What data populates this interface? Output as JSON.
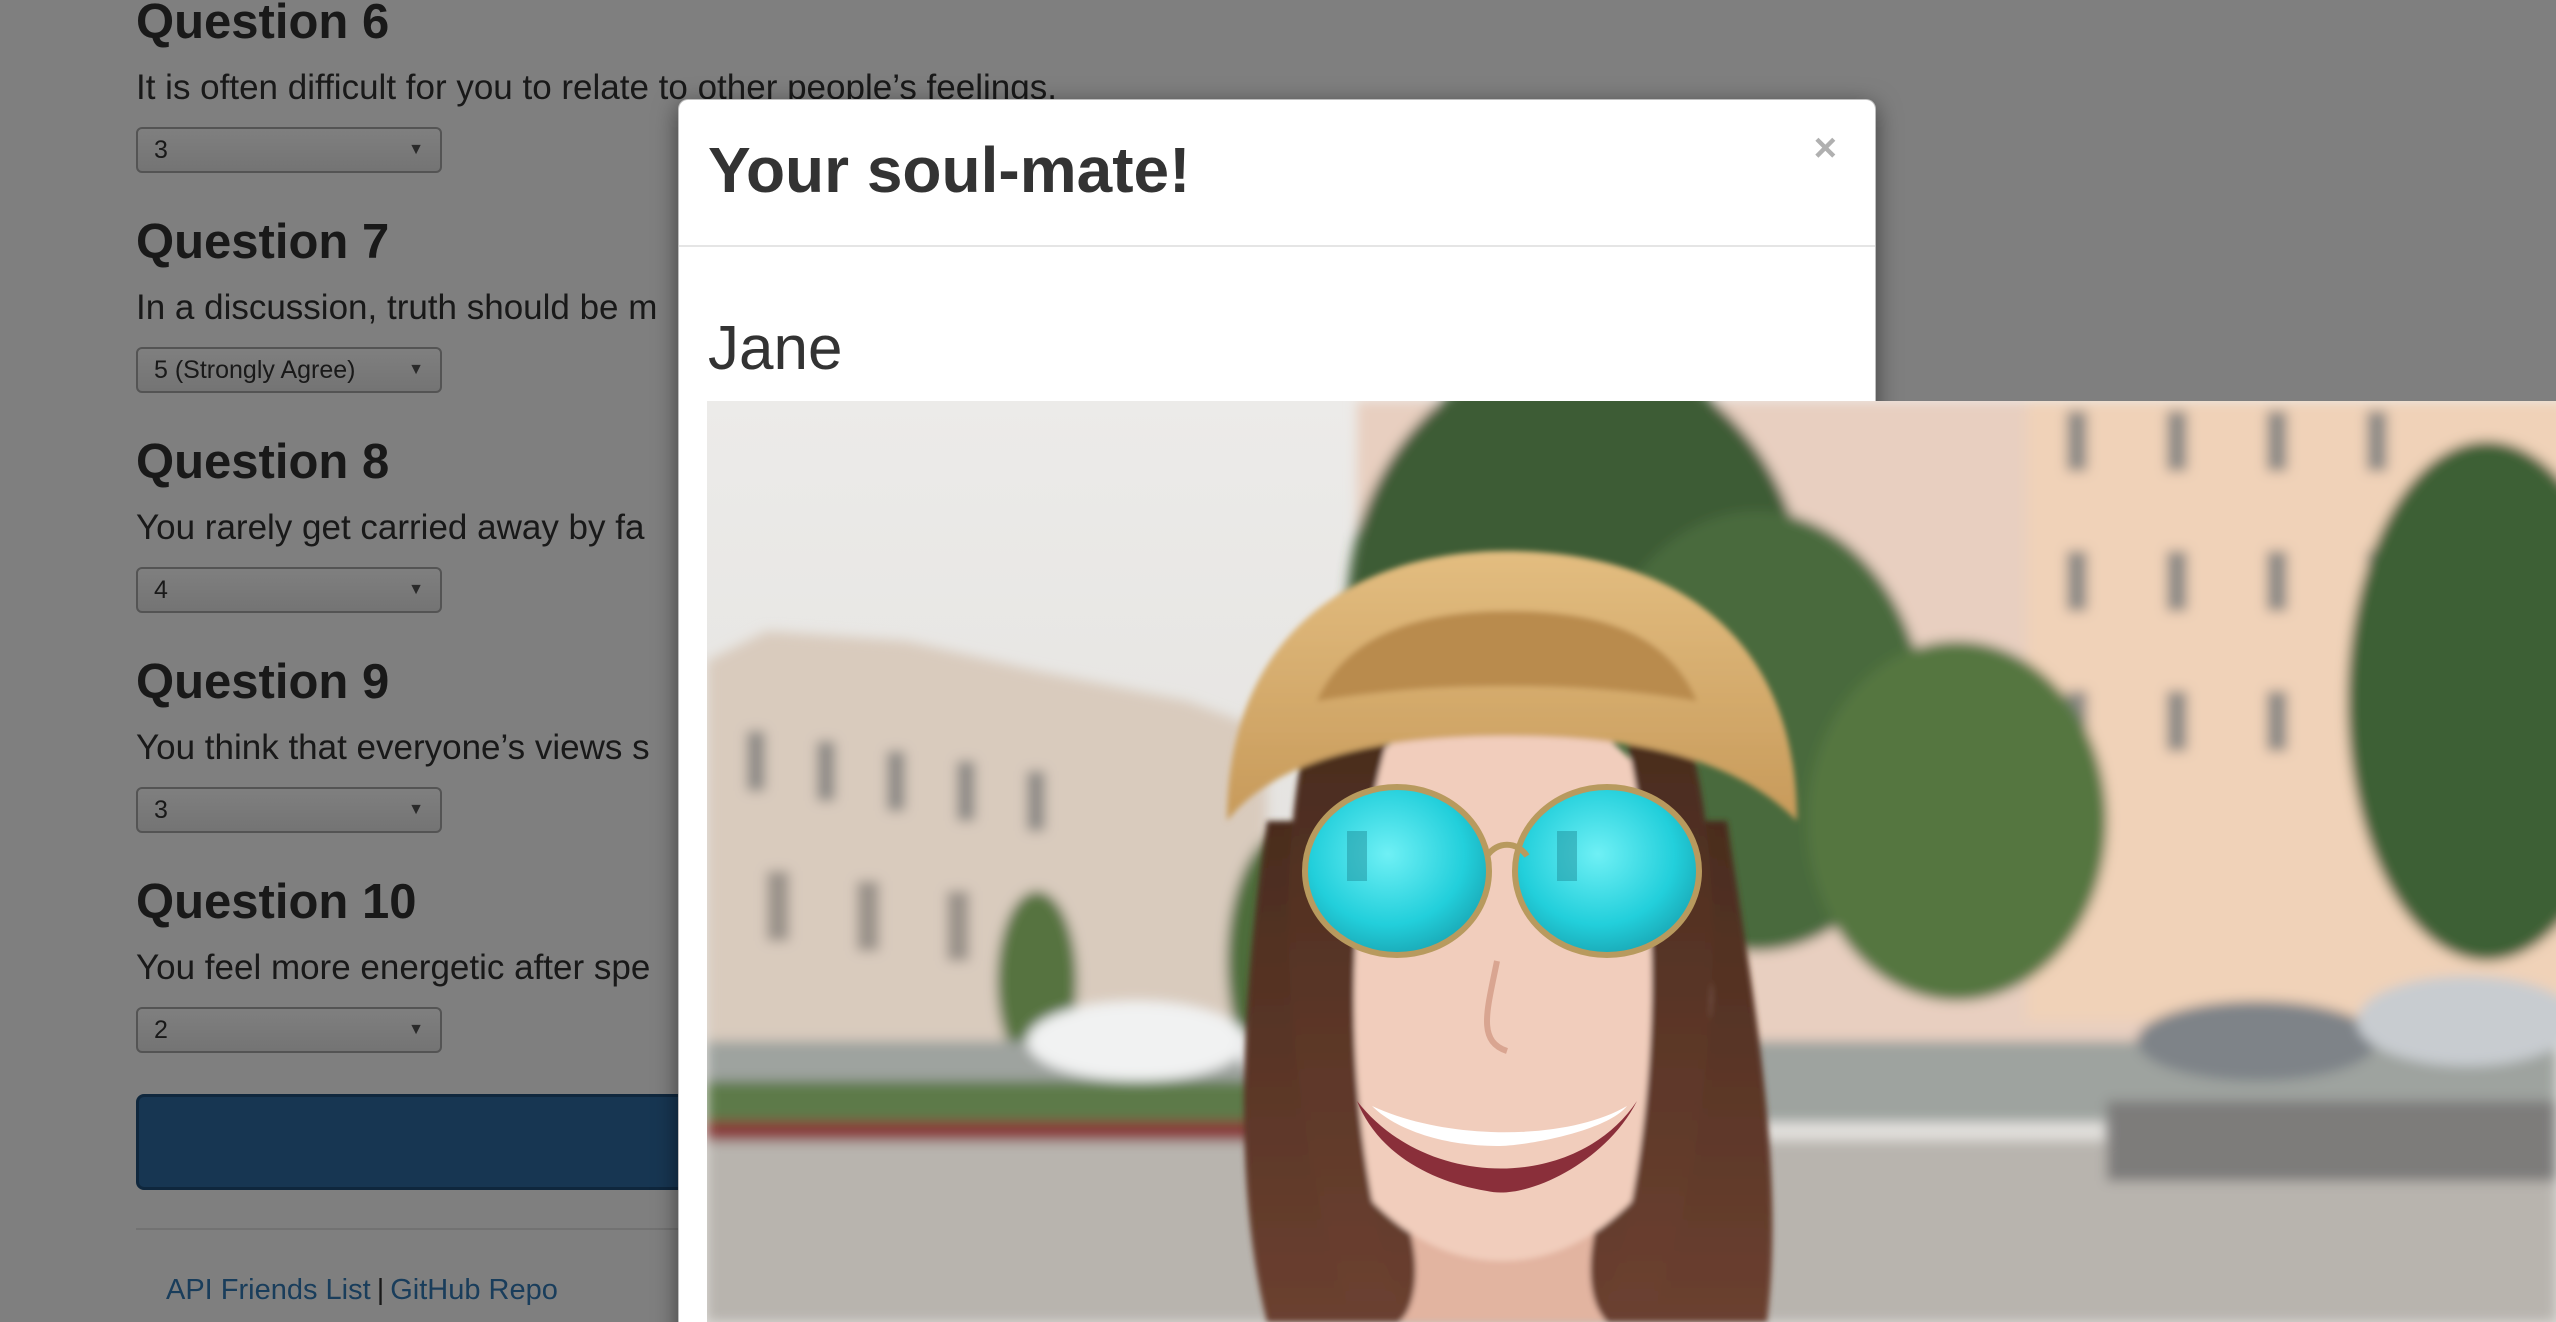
{
  "questions": [
    {
      "title": "Question 6",
      "text": "It is often difficult for you to relate to other people’s feelings.",
      "selected": "3"
    },
    {
      "title": "Question 7",
      "text": "In a discussion, truth should be m",
      "selected": "5 (Strongly Agree)"
    },
    {
      "title": "Question 8",
      "text": "You rarely get carried away by fa",
      "selected": "4"
    },
    {
      "title": "Question 9",
      "text": "You think that everyone’s views s",
      "selected": "3"
    },
    {
      "title": "Question 10",
      "text": "You feel more energetic after spe",
      "selected": "2"
    }
  ],
  "footer": {
    "api_link": "API Friends List",
    "separator": "|",
    "repo_link": "GitHub Repo"
  },
  "modal": {
    "title": "Your soul-mate!",
    "close_symbol": "×",
    "match_name": "Jane"
  },
  "icons": {
    "select_arrow": "caret-down-icon",
    "close": "close-icon"
  },
  "colors": {
    "backdrop": "rgba(0,0,0,0.5)",
    "primary_button": "#2e6da4",
    "link": "#337ab7",
    "sunglasses_lens": "#2ed6e0",
    "hat": "#d6aa68"
  }
}
